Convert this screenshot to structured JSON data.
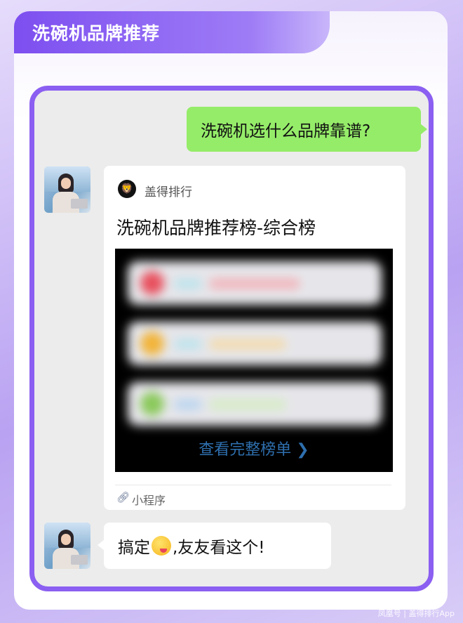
{
  "header": {
    "title": "洗碗机品牌推荐"
  },
  "messages": {
    "question": "洗碗机选什么品牌靠谱?",
    "card": {
      "source_name": "盖得排行",
      "logo_glyph": "🦁",
      "title": "洗碗机品牌推荐榜-综合榜",
      "preview_link": "查看完整榜单 ❯",
      "mini_program_icon": "link-icon",
      "mini_program_label": "小程序"
    },
    "reply_before": "搞定",
    "reply_after": ",友友看这个!"
  },
  "watermark": "凤凰号 | 盖得排行App",
  "colors": {
    "brand_purple": "#8b5ff1",
    "bubble_green": "#95ec69",
    "link_blue": "#2e6fae"
  }
}
